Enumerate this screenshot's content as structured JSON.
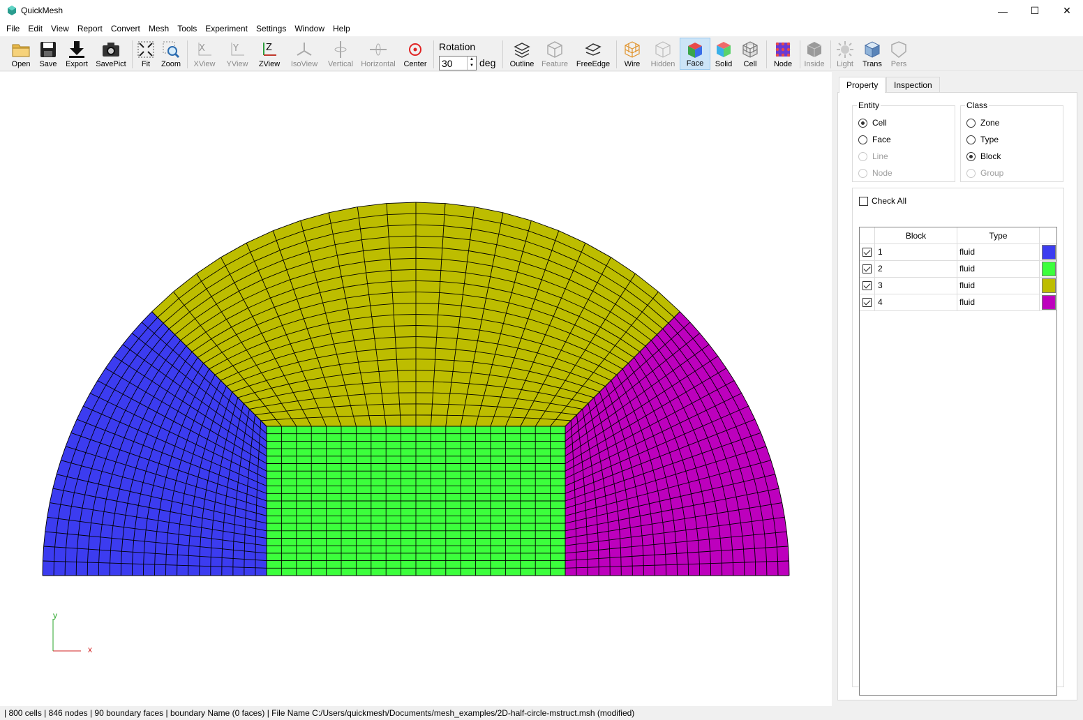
{
  "window": {
    "title": "QuickMesh",
    "controls": {
      "minimize": "—",
      "maximize": "☐",
      "close": "✕"
    }
  },
  "menu": [
    "File",
    "Edit",
    "View",
    "Report",
    "Convert",
    "Mesh",
    "Tools",
    "Experiment",
    "Settings",
    "Window",
    "Help"
  ],
  "toolbar": {
    "buttons": [
      {
        "label": "Open",
        "icon": "folder-icon"
      },
      {
        "label": "Save",
        "icon": "save-icon"
      },
      {
        "label": "Export",
        "icon": "export-icon"
      },
      {
        "label": "SavePict",
        "icon": "camera-icon"
      },
      {
        "label": "Fit",
        "icon": "fit-icon"
      },
      {
        "label": "Zoom",
        "icon": "zoom-icon"
      },
      {
        "label": "XView",
        "icon": "xview-icon"
      },
      {
        "label": "YView",
        "icon": "yview-icon"
      },
      {
        "label": "ZView",
        "icon": "zview-icon"
      },
      {
        "label": "IsoView",
        "icon": "isoview-icon"
      },
      {
        "label": "Vertical",
        "icon": "vertical-rotate-icon"
      },
      {
        "label": "Horizontal",
        "icon": "horizontal-rotate-icon"
      },
      {
        "label": "Center",
        "icon": "center-icon"
      },
      {
        "label": "Outline",
        "icon": "outline-icon"
      },
      {
        "label": "Feature",
        "icon": "feature-icon"
      },
      {
        "label": "FreeEdge",
        "icon": "freeedge-icon"
      },
      {
        "label": "Wire",
        "icon": "wire-icon"
      },
      {
        "label": "Hidden",
        "icon": "hidden-icon"
      },
      {
        "label": "Face",
        "icon": "face-icon"
      },
      {
        "label": "Solid",
        "icon": "solid-icon"
      },
      {
        "label": "Cell",
        "icon": "cell-icon"
      },
      {
        "label": "Node",
        "icon": "node-icon"
      },
      {
        "label": "Inside",
        "icon": "inside-icon"
      },
      {
        "label": "Light",
        "icon": "light-icon"
      },
      {
        "label": "Trans",
        "icon": "trans-icon"
      },
      {
        "label": "Pers",
        "icon": "pers-icon"
      }
    ],
    "rotation": {
      "label": "Rotation",
      "value": "30",
      "unit": "deg"
    }
  },
  "viewport": {
    "axis": {
      "y_label": "y",
      "x_label": "x"
    },
    "block_colors": {
      "1": "#3c3cf0",
      "2": "#3cff3c",
      "3": "#bdbd00",
      "4": "#bd00bd"
    }
  },
  "panel": {
    "tabs": [
      "Property",
      "Inspection"
    ],
    "entity": {
      "title": "Entity",
      "options": [
        {
          "label": "Cell",
          "checked": true,
          "enabled": true
        },
        {
          "label": "Face",
          "checked": false,
          "enabled": true
        },
        {
          "label": "Line",
          "checked": false,
          "enabled": false
        },
        {
          "label": "Node",
          "checked": false,
          "enabled": false
        }
      ]
    },
    "class": {
      "title": "Class",
      "options": [
        {
          "label": "Zone",
          "checked": false,
          "enabled": true
        },
        {
          "label": "Type",
          "checked": false,
          "enabled": true
        },
        {
          "label": "Block",
          "checked": true,
          "enabled": true
        },
        {
          "label": "Group",
          "checked": false,
          "enabled": false
        }
      ]
    },
    "check_all": "Check All",
    "table": {
      "headers": [
        "Block",
        "Type"
      ],
      "rows": [
        {
          "block": "1",
          "type": "fluid",
          "color": "#3c3cf0"
        },
        {
          "block": "2",
          "type": "fluid",
          "color": "#3cff3c"
        },
        {
          "block": "3",
          "type": "fluid",
          "color": "#bdbd00"
        },
        {
          "block": "4",
          "type": "fluid",
          "color": "#bd00bd"
        }
      ]
    }
  },
  "status": "| 800 cells | 846 nodes | 90 boundary faces |  boundary Name  (0 faces) | File Name C:/Users/quickmesh/Documents/mesh_examples/2D-half-circle-mstruct.msh (modified)"
}
